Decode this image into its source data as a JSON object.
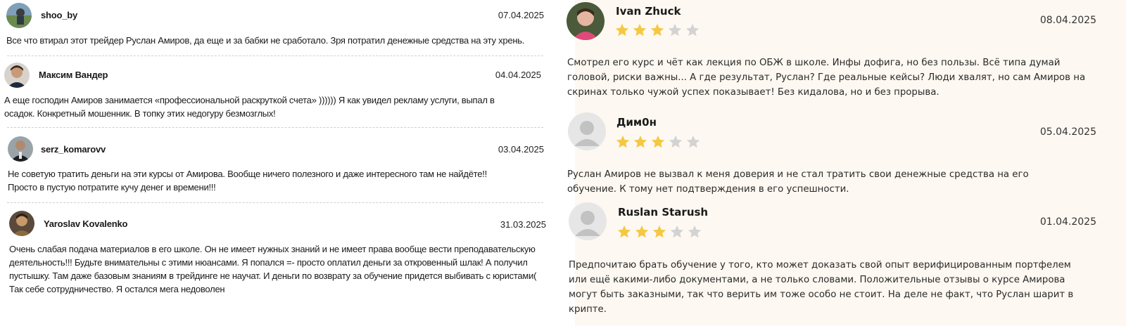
{
  "left_reviews": [
    {
      "author": "shoo_by",
      "date": "07.04.2025",
      "text": "Все что втирал этот трейдер Руслан Амиров, да еще и за бабки не сработало. Зря потратил денежные средства на эту хрень."
    },
    {
      "author": "Максим Вандер",
      "date": "04.04.2025",
      "text": "А еще господин Амиров занимается «профессиональной раскруткой счета» )))))) Я как увидел рекламу услуги, выпал в осадок. Конкретный мошенник. В топку этих недогуру безмозглых!"
    },
    {
      "author": "serz_komarovv",
      "date": "03.04.2025",
      "text": "Не советую тратить деньги на эти курсы от Амирова. Вообще ничего полезного и даже интересного там не найдёте!! Просто в пустую потратите кучу денег и времени!!!"
    },
    {
      "author": "Yaroslav Kovalenko",
      "date": "31.03.2025",
      "text": "Очень слабая подача материалов в его школе. Он не имеет нужных знаний и не имеет права вообще вести преподавательскую деятельность!!! Будьте внимательны с этими нюансами. Я попался =- просто оплатил деньги за откровенный шлак! А получил пустышку. Там даже базовым знаниям в трейдинге не научат. И деньги по возврату за обучение придется выбивать с юристами( Так себе сотрудничество. Я остался мега недоволен"
    }
  ],
  "right_reviews": [
    {
      "author": "Ivan Zhuck",
      "date": "08.04.2025",
      "rating": 3,
      "max_rating": 5,
      "text": "Смотрел его курс и чёт как лекция по ОБЖ в школе. Инфы дофига, но без пользы. Всё типа думай головой, риски важны... А где результат, Руслан? Где реальные кейсы? Люди хвалят, но сам Амиров на скринах только чужой успех показывает! Без кидалова, но и без прорыва."
    },
    {
      "author": "Дим0н",
      "date": "05.04.2025",
      "rating": 3,
      "max_rating": 5,
      "text": "Руслан Амиров не вызвал к меня доверия и не стал тратить свои денежные средства на его обучение. К тому нет подтверждения в его успешности."
    },
    {
      "author": "Ruslan Starush",
      "date": "01.04.2025",
      "rating": 3,
      "max_rating": 5,
      "text": "Предпочитаю брать обучение у того, кто может доказать свой опыт верифицированным портфелем или ещё какими-либо документами, а не только словами. Положительные отзывы о курсе Амирова могут быть заказными, так что верить им тоже особо не стоит. На деле не факт, что Руслан шарит в крипте."
    }
  ],
  "colors": {
    "star_filled": "#f5c842",
    "star_empty": "#d3d3d3",
    "right_bg": "#fdf8f1",
    "divider": "#cfcfcf"
  }
}
